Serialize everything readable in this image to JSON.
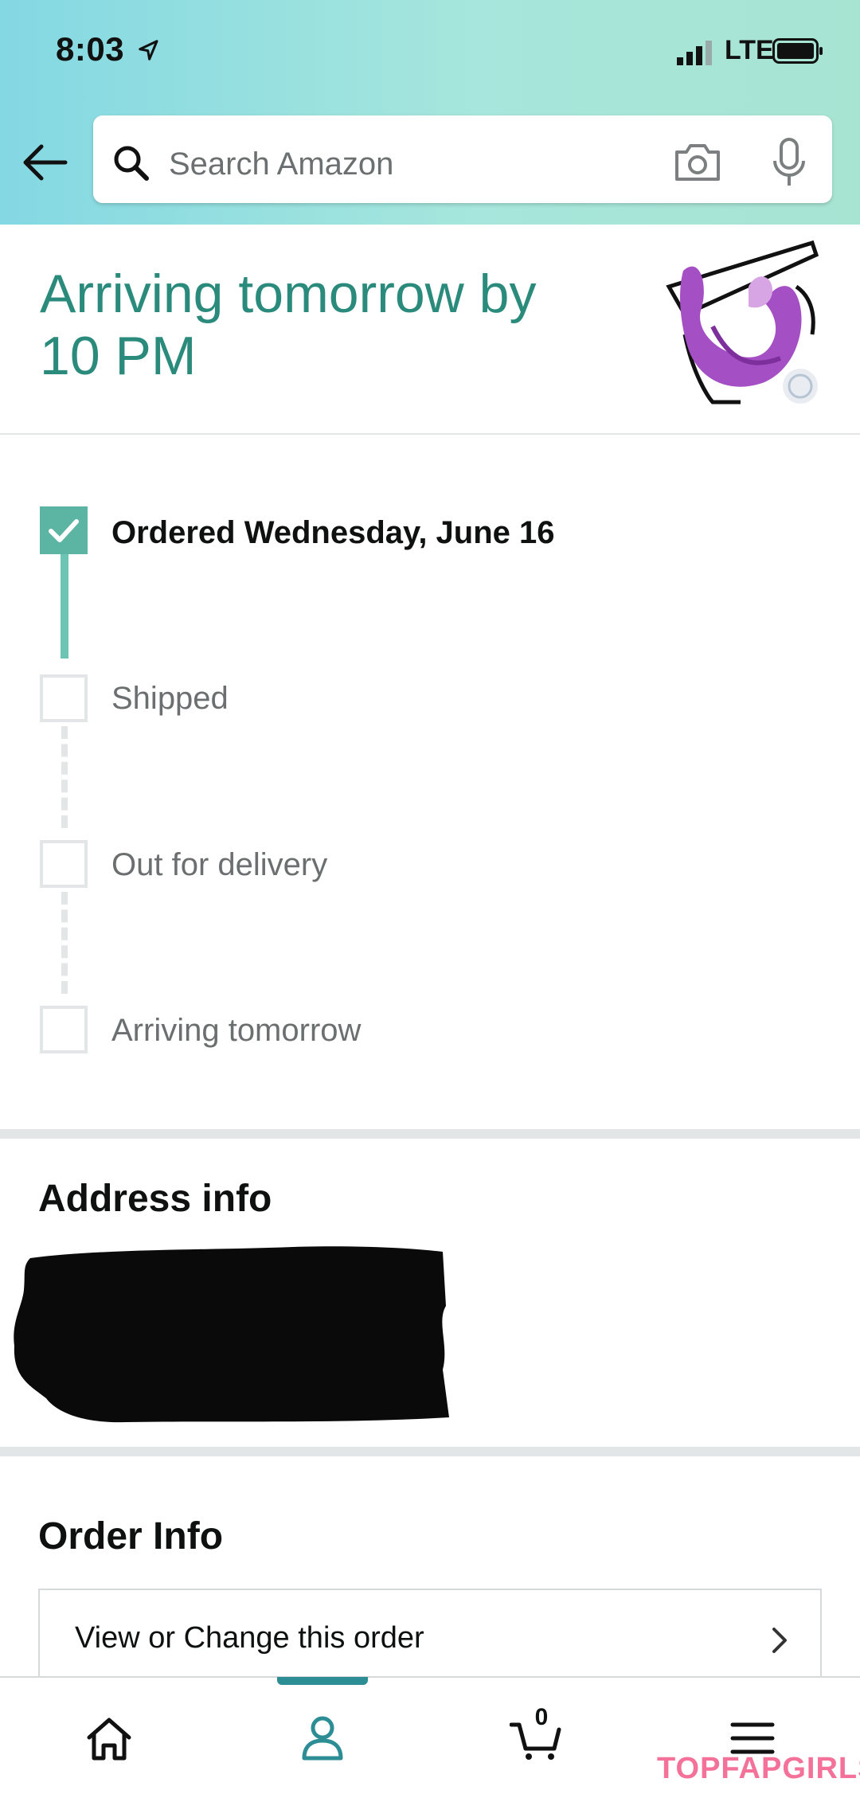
{
  "status_bar": {
    "time": "8:03",
    "network": "LTE"
  },
  "search": {
    "placeholder": "Search Amazon"
  },
  "delivery": {
    "title": "Arriving tomorrow by 10 PM"
  },
  "tracker": {
    "steps": [
      {
        "label": "Ordered Wednesday, June 16",
        "done": true
      },
      {
        "label": "Shipped",
        "done": false
      },
      {
        "label": "Out for delivery",
        "done": false
      },
      {
        "label": "Arriving tomorrow",
        "done": false
      }
    ]
  },
  "address": {
    "title": "Address info"
  },
  "order_info": {
    "title": "Order Info",
    "view_change_label": "View or Change this order"
  },
  "bottom_nav": {
    "cart_count": "0"
  },
  "watermark": "TOPFAPGIRLS",
  "colors": {
    "accent": "#2a8a7b",
    "progress": "#5cb5a3",
    "nav_indicator": "#2c8d94",
    "divider": "#e3e6e6"
  }
}
